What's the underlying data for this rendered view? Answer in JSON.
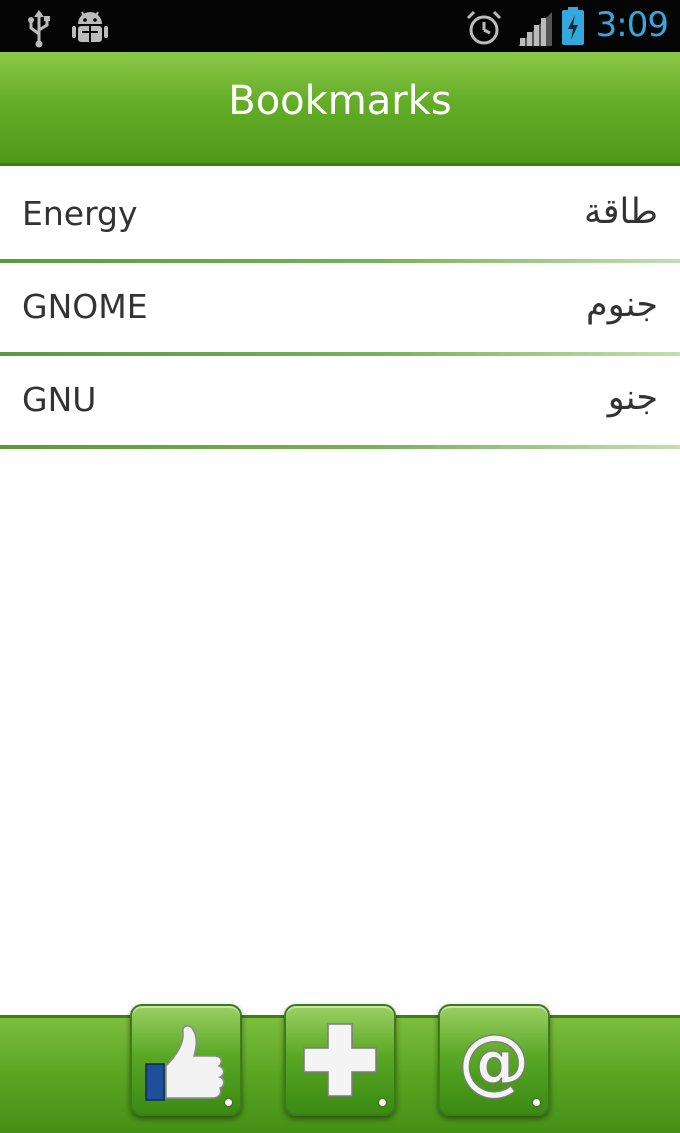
{
  "status_bar": {
    "time": "3:09",
    "icons": [
      "usb-icon",
      "android-debug-icon",
      "alarm-icon",
      "signal-icon",
      "battery-icon"
    ]
  },
  "header": {
    "title": "Bookmarks"
  },
  "bookmarks": [
    {
      "english": "Energy",
      "arabic": "طاقة"
    },
    {
      "english": "GNOME",
      "arabic": "جنوم"
    },
    {
      "english": "GNU",
      "arabic": "جنو"
    }
  ],
  "toolbar": {
    "buttons": [
      {
        "icon": "thumbs-up-icon"
      },
      {
        "icon": "plus-icon"
      },
      {
        "icon": "at-sign-icon"
      }
    ]
  },
  "colors": {
    "accent_green": "#64ad27",
    "status_time": "#34a7dd",
    "status_bar_bg": "#050505"
  }
}
